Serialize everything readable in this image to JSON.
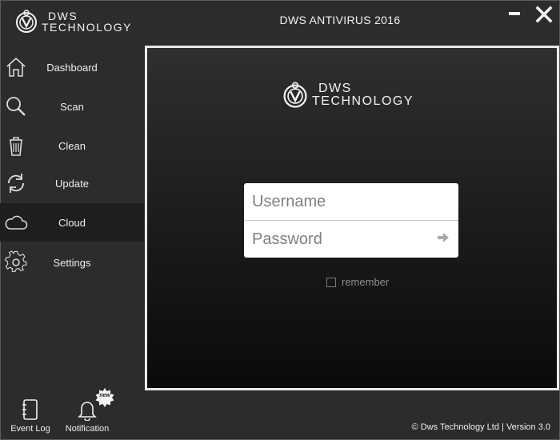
{
  "app": {
    "title": "DWS ANTIVIRUS 2016",
    "brand_line1": "DWS",
    "brand_line2": "TECHNOLOGY"
  },
  "window_controls": {
    "minimize_icon": "minimize-icon",
    "close_icon": "close-icon"
  },
  "sidebar": {
    "items": [
      {
        "label": "Dashboard",
        "icon": "home-icon",
        "active": false
      },
      {
        "label": "Scan",
        "icon": "magnifier-icon",
        "active": false
      },
      {
        "label": "Clean",
        "icon": "trash-icon",
        "active": false
      },
      {
        "label": "Update",
        "icon": "refresh-icon",
        "active": false
      },
      {
        "label": "Cloud",
        "icon": "cloud-icon",
        "active": true
      },
      {
        "label": "Settings",
        "icon": "gear-icon",
        "active": false
      }
    ]
  },
  "login": {
    "username_placeholder": "Username",
    "password_placeholder": "Password",
    "remember_label": "remember",
    "remember_checked": false
  },
  "bottom": {
    "event_log_label": "Event Log",
    "notification_label": "Notification",
    "new_badge": "new"
  },
  "footer": {
    "copyright_symbol": "©",
    "company": "Dws Technology Ltd",
    "separator": "|",
    "version": "Version 3.0"
  },
  "colors": {
    "background": "#2b2c2e",
    "active_item": "#1d1e20",
    "panel_border": "#e9e9e9",
    "text": "#efefef"
  }
}
